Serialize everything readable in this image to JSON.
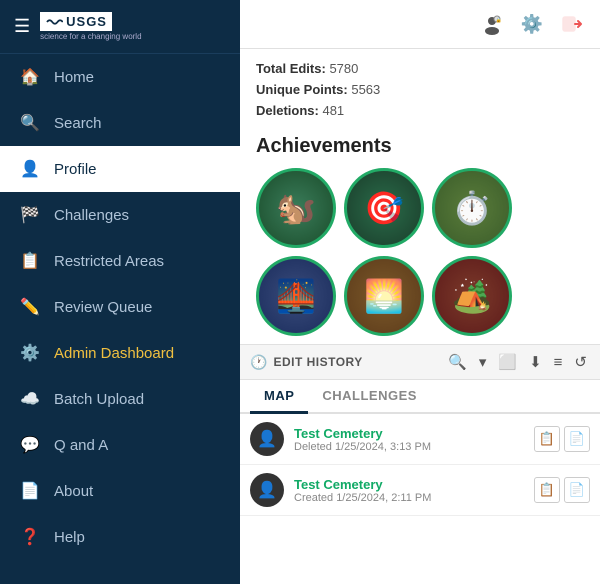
{
  "sidebar": {
    "logo_text": "USGS",
    "tagline": "science for a changing world",
    "nav_items": [
      {
        "id": "home",
        "label": "Home",
        "icon": "🏠",
        "active": false,
        "highlight": false
      },
      {
        "id": "search",
        "label": "Search",
        "icon": "🔍",
        "active": false,
        "highlight": false
      },
      {
        "id": "profile",
        "label": "Profile",
        "icon": "👤",
        "active": true,
        "highlight": false
      },
      {
        "id": "challenges",
        "label": "Challenges",
        "icon": "🏁",
        "active": false,
        "highlight": false
      },
      {
        "id": "restricted-areas",
        "label": "Restricted Areas",
        "icon": "📋",
        "active": false,
        "highlight": false
      },
      {
        "id": "review-queue",
        "label": "Review Queue",
        "icon": "✏️",
        "active": false,
        "highlight": false
      },
      {
        "id": "admin-dashboard",
        "label": "Admin Dashboard",
        "icon": "⚙️",
        "active": false,
        "highlight": true
      },
      {
        "id": "batch-upload",
        "label": "Batch Upload",
        "icon": "☁️",
        "active": false,
        "highlight": false
      },
      {
        "id": "q-and-a",
        "label": "Q and A",
        "icon": "💬",
        "active": false,
        "highlight": false
      },
      {
        "id": "about",
        "label": "About",
        "icon": "📄",
        "active": false,
        "highlight": false
      },
      {
        "id": "help",
        "label": "Help",
        "icon": "❓",
        "active": false,
        "highlight": false
      }
    ]
  },
  "toolbar": {
    "profile_icon": "👤",
    "settings_icon": "⚙️",
    "logout_icon": "➡️"
  },
  "stats": {
    "total_edits_label": "Total Edits:",
    "total_edits_value": "5780",
    "unique_points_label": "Unique Points:",
    "unique_points_value": "5563",
    "deletions_label": "Deletions:",
    "deletions_value": "481"
  },
  "achievements": {
    "title": "Achievements",
    "badges": [
      {
        "emoji": "🐿️",
        "color1": "#3a7c5a",
        "color2": "#1a4c2a"
      },
      {
        "emoji": "🎯",
        "color1": "#2a6c4a",
        "color2": "#1a3c2a"
      },
      {
        "emoji": "⏱️",
        "color1": "#5a7c3a",
        "color2": "#3a5c2a"
      },
      {
        "emoji": "🌉",
        "color1": "#3a4c7c",
        "color2": "#1a2c5c"
      },
      {
        "emoji": "🌅",
        "color1": "#7c5a2a",
        "color2": "#5c3a1a"
      },
      {
        "emoji": "🏕️",
        "color1": "#7c3a2a",
        "color2": "#5c1a1a"
      }
    ]
  },
  "edit_history": {
    "label": "EDIT HISTORY"
  },
  "tabs": [
    {
      "id": "map",
      "label": "MAP",
      "active": true
    },
    {
      "id": "challenges",
      "label": "CHALLENGES",
      "active": false
    }
  ],
  "records": [
    {
      "title": "Test Cemetery",
      "subtitle": "Deleted 1/25/2024, 3:13 PM"
    },
    {
      "title": "Test Cemetery",
      "subtitle": "Created 1/25/2024, 2:11 PM"
    }
  ]
}
